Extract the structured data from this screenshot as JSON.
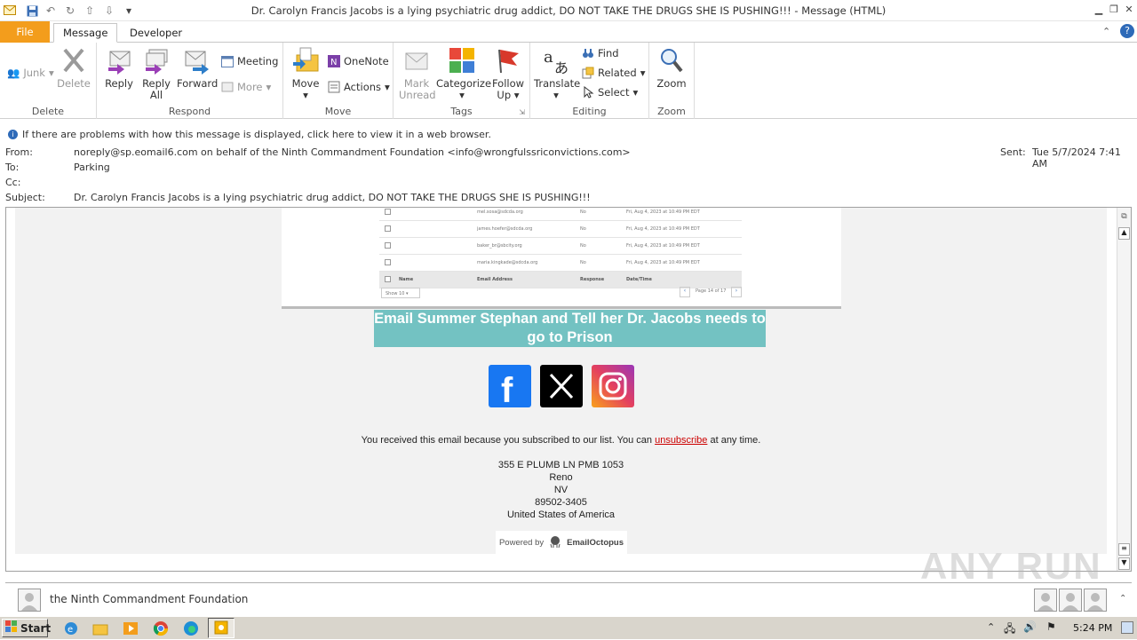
{
  "window": {
    "title": "Dr. Carolyn Francis Jacobs is a lying psychiatric drug addict, DO NOT TAKE THE DRUGS SHE IS PUSHING!!!  -  Message (HTML)"
  },
  "tabs": [
    {
      "label": "File"
    },
    {
      "label": "Message"
    },
    {
      "label": "Developer"
    }
  ],
  "ribbon": {
    "delete_group": {
      "label": "Delete",
      "junk": "Junk",
      "delete": "Delete"
    },
    "respond_group": {
      "label": "Respond",
      "reply": "Reply",
      "reply_all_1": "Reply",
      "reply_all_2": "All",
      "forward": "Forward",
      "meeting": "Meeting",
      "more": "More"
    },
    "move_group": {
      "label": "Move",
      "move": "Move",
      "onenote": "OneNote",
      "actions": "Actions"
    },
    "tags_group": {
      "label": "Tags",
      "mark_unread_1": "Mark",
      "mark_unread_2": "Unread",
      "categorize": "Categorize",
      "follow_up_1": "Follow",
      "follow_up_2": "Up"
    },
    "editing_group": {
      "label": "Editing",
      "translate": "Translate",
      "find": "Find",
      "related": "Related",
      "select": "Select"
    },
    "zoom_group": {
      "label": "Zoom",
      "zoom": "Zoom"
    }
  },
  "message": {
    "info": "If there are problems with how this message is displayed, click here to view it in a web browser.",
    "from_label": "From:",
    "from_value": "noreply@sp.eomail6.com on behalf of the Ninth Commandment Foundation <info@wrongfulssriconvictions.com>",
    "to_label": "To:",
    "to_value": "Parking",
    "cc_label": "Cc:",
    "subject_label": "Subject:",
    "subject_value": "Dr. Carolyn Francis Jacobs is a lying psychiatric drug addict, DO NOT TAKE THE DRUGS SHE IS PUSHING!!!",
    "sent_label": "Sent:",
    "sent_value": "Tue 5/7/2024 7:41 AM"
  },
  "email_body": {
    "table_rows": [
      {
        "email": "mel.sosa@sdcda.org",
        "response": "No",
        "datetime": "Fri, Aug 4, 2023 at 10:49 PM EDT"
      },
      {
        "email": "james.hoefer@sdcda.org",
        "response": "No",
        "datetime": "Fri, Aug 4, 2023 at 10:49 PM EDT"
      },
      {
        "email": "baker_br@sbcity.org",
        "response": "No",
        "datetime": "Fri, Aug 4, 2023 at 10:49 PM EDT"
      },
      {
        "email": "maria.kingkade@sdcda.org",
        "response": "No",
        "datetime": "Fri, Aug 4, 2023 at 10:49 PM EDT"
      }
    ],
    "table_header": {
      "name": "Name",
      "email": "Email Address",
      "response": "Response",
      "datetime": "Date/Time"
    },
    "show_select": "Show 10",
    "pagination": "Page 14 of 17",
    "banner": "Email Summer Stephan and Tell her Dr. Jacobs needs to go to Prison",
    "subscribed_prefix": "You received this email because you subscribed to our list. You can",
    "unsubscribe": "unsubscribe",
    "subscribed_suffix": "at any time.",
    "address_line1": "355 E PLUMB LN PMB 1053",
    "address_city": "Reno",
    "address_state": "NV",
    "address_zip": "89502-3405",
    "address_country": "United States of America",
    "powered_by": "Powered by",
    "powered_brand": "EmailOctopus"
  },
  "people_pane": {
    "name": "the Ninth Commandment Foundation"
  },
  "taskbar": {
    "start": "Start",
    "clock": "5:24 PM"
  },
  "watermark": "ANY RUN",
  "colors": {
    "file_tab": "#f39d1c",
    "banner": "#73c2c2",
    "unsubscribe": "#cc0000"
  }
}
